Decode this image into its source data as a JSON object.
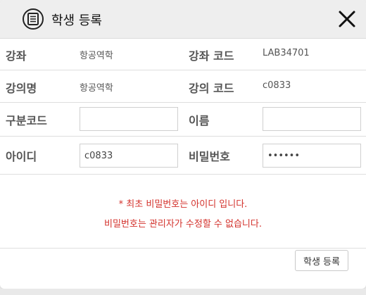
{
  "dialog": {
    "title": "학생 등록",
    "icon": "document-icon",
    "close_icon": "close-icon"
  },
  "fields": {
    "course_label": "강좌",
    "course_value": "항공역학",
    "course_code_label": "강좌 코드",
    "course_code_value": "LAB34701",
    "lecture_name_label": "강의명",
    "lecture_name_value": "항공역학",
    "lecture_code_label": "강의 코드",
    "lecture_code_value": "c0833",
    "division_code_label": "구분코드",
    "division_code_value": "",
    "name_label": "이름",
    "name_value": "",
    "id_label": "아이디",
    "id_value": "c0833",
    "password_label": "비밀번호",
    "password_value": "••••••"
  },
  "notice": {
    "line1": "* 최초 비밀번호는 아이디 입니다.",
    "line2": "비밀번호는 관리자가 수정할 수 없습니다.",
    "color": "#d3302a"
  },
  "footer": {
    "submit_label": "학생 등록"
  }
}
